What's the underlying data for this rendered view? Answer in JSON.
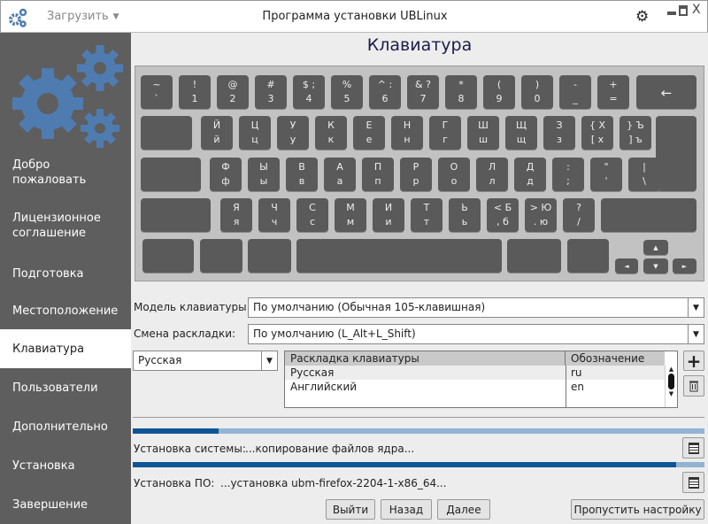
{
  "titlebar": {
    "title": "Программа установки UBLinux",
    "load_label": "Загрузить",
    "window_controls": {
      "minimize": "▬",
      "maximize": "▭",
      "close": "X"
    }
  },
  "sidebar": {
    "items": [
      {
        "label": "Добро пожаловать",
        "active": false
      },
      {
        "label": "Лицензионное соглашение",
        "active": false
      },
      {
        "label": "Подготовка",
        "active": false
      },
      {
        "label": "Местоположение",
        "active": false
      },
      {
        "label": "Клавиатура",
        "active": true
      },
      {
        "label": "Пользователи",
        "active": false
      },
      {
        "label": "Дополнительно",
        "active": false
      },
      {
        "label": "Установка",
        "active": false
      },
      {
        "label": "Завершение",
        "active": false
      }
    ]
  },
  "page_title": "Клавиатура",
  "keyboard": {
    "rows": [
      [
        [
          "~",
          "`"
        ],
        [
          "!",
          "1"
        ],
        [
          "@",
          "2"
        ],
        [
          "#",
          "3"
        ],
        [
          "$ ;",
          "4"
        ],
        [
          "%",
          "5"
        ],
        [
          "^ :",
          "6"
        ],
        [
          "& ?",
          "7"
        ],
        [
          "*",
          "8"
        ],
        [
          "(",
          "9"
        ],
        [
          ")",
          "0"
        ],
        [
          "-",
          "_"
        ],
        [
          "+",
          "="
        ],
        [
          "←",
          ""
        ]
      ],
      [
        [
          "",
          ""
        ],
        [
          "Й",
          "й"
        ],
        [
          "Ц",
          "ц"
        ],
        [
          "У",
          "у"
        ],
        [
          "К",
          "к"
        ],
        [
          "Е",
          "е"
        ],
        [
          "Н",
          "н"
        ],
        [
          "Г",
          "г"
        ],
        [
          "Ш",
          "ш"
        ],
        [
          "Щ",
          "щ"
        ],
        [
          "З",
          "з"
        ],
        [
          "{ Х",
          "[ х"
        ],
        [
          "} Ъ",
          "] ъ"
        ],
        [
          "",
          ""
        ]
      ],
      [
        [
          "",
          ""
        ],
        [
          "Ф",
          "ф"
        ],
        [
          "Ы",
          "ы"
        ],
        [
          "В",
          "в"
        ],
        [
          "А",
          "а"
        ],
        [
          "П",
          "п"
        ],
        [
          "Р",
          "р"
        ],
        [
          "О",
          "о"
        ],
        [
          "Л",
          "л"
        ],
        [
          "Д",
          "д"
        ],
        [
          ":",
          ";"
        ],
        [
          "\"",
          "'"
        ],
        [
          "|",
          "\\"
        ]
      ],
      [
        [
          "",
          ""
        ],
        [
          "Я",
          "я"
        ],
        [
          "Ч",
          "ч"
        ],
        [
          "С",
          "с"
        ],
        [
          "М",
          "м"
        ],
        [
          "И",
          "и"
        ],
        [
          "Т",
          "т"
        ],
        [
          "Ь",
          "ь"
        ],
        [
          "< Б",
          ", б"
        ],
        [
          "> Ю",
          ". ю"
        ],
        [
          "?",
          "/"
        ],
        [
          "",
          ""
        ]
      ],
      [
        [
          "",
          ""
        ],
        [
          "",
          ""
        ],
        [
          "",
          ""
        ],
        [
          "",
          ""
        ],
        [
          "",
          ""
        ],
        [
          "",
          ""
        ],
        [
          "▲",
          ""
        ],
        [
          "◄",
          ""
        ],
        [
          "▼",
          ""
        ],
        [
          "►",
          ""
        ]
      ]
    ]
  },
  "form": {
    "model_label": "Модель клавиатуры:",
    "model_value": "По умолчанию (Обычная 105-клавишная)",
    "switch_label": "Смена раскладки:",
    "switch_value": "По умолчанию (L_Alt+L_Shift)",
    "layout_combo_value": "Русская",
    "table": {
      "headers": [
        "Раскладка клавиатуры",
        "Обозначение"
      ],
      "rows": [
        [
          "Русская",
          "ru"
        ],
        [
          "Английский",
          "en"
        ]
      ]
    }
  },
  "progress": {
    "system_label": "Установка системы:",
    "system_status": "...копирование файлов ядра...",
    "system_percent": 15,
    "software_label": "Установка ПО:",
    "software_status": "...установка ubm-firefox-2204-1-x86_64...",
    "software_percent": 95
  },
  "buttons": {
    "exit": "Выйти",
    "back": "Назад",
    "next": "Далее",
    "skip": "Пропустить настройку"
  },
  "colors": {
    "accent": "#0e5597",
    "sidebar": "#5e5e5e",
    "logo": "#4f7cb0"
  }
}
